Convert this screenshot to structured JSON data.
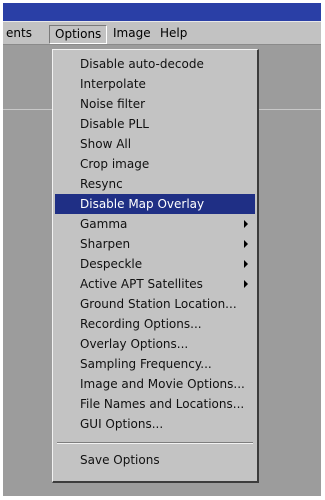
{
  "menubar": {
    "items": [
      {
        "label": "ents"
      },
      {
        "label": "Options"
      },
      {
        "label": "Image"
      },
      {
        "label": "Help"
      }
    ]
  },
  "options_menu": {
    "items": [
      {
        "label": "Disable auto-decode"
      },
      {
        "label": "Interpolate"
      },
      {
        "label": "Noise filter"
      },
      {
        "label": "Disable PLL"
      },
      {
        "label": "Show All"
      },
      {
        "label": "Crop image"
      },
      {
        "label": "Resync"
      },
      {
        "label": "Disable Map Overlay",
        "selected": true
      },
      {
        "label": "Gamma",
        "submenu": true
      },
      {
        "label": "Sharpen",
        "submenu": true
      },
      {
        "label": "Despeckle",
        "submenu": true
      },
      {
        "label": "Active APT Satellites",
        "submenu": true
      },
      {
        "label": "Ground Station Location..."
      },
      {
        "label": "Recording Options..."
      },
      {
        "label": "Overlay Options..."
      },
      {
        "label": "Sampling Frequency..."
      },
      {
        "label": "Image and Movie Options..."
      },
      {
        "label": "File Names and Locations..."
      },
      {
        "label": "GUI Options..."
      },
      {
        "label": "Save Options"
      }
    ]
  },
  "colors": {
    "title_bar": "#2a3fa6",
    "menu_face": "#c3c3c3",
    "highlight": "#1f2f85"
  }
}
